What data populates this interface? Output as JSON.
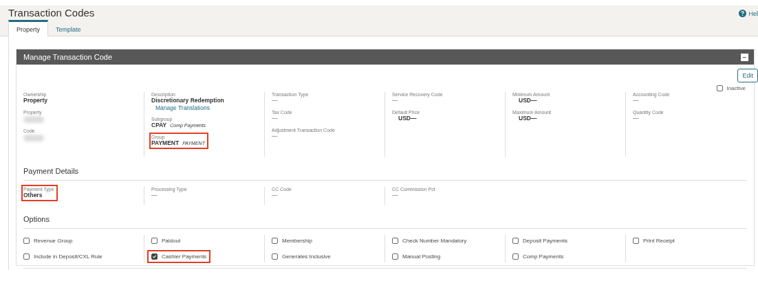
{
  "page": {
    "title": "Transaction Codes",
    "help": "Hel"
  },
  "tabs": [
    {
      "label": "Property",
      "selected": true
    },
    {
      "label": "Template",
      "selected": false
    }
  ],
  "panel": {
    "title": "Manage Transaction Code",
    "collapse": "−",
    "edit": "Edit",
    "inactive": {
      "label": "Inactive",
      "checked": false
    }
  },
  "details": {
    "columns": [
      [
        {
          "label": "Ownership",
          "kind": "bold",
          "value": "Property",
          "highlighted": false
        },
        {
          "label": "Property",
          "kind": "redacted",
          "highlighted": false
        },
        {
          "label": "Code",
          "kind": "redacted",
          "highlighted": false
        }
      ],
      [
        {
          "label": "Description",
          "kind": "bold",
          "value": "Discretionary Redemption",
          "link": "Manage Translations",
          "highlighted": false
        },
        {
          "label": "Subgroup",
          "kind": "bold",
          "value": "CPAY",
          "note": "Comp Payments",
          "highlighted": false
        },
        {
          "label": "Group",
          "kind": "bold",
          "value": "PAYMENT",
          "note": "PAYMENT",
          "highlighted": true
        }
      ],
      [
        {
          "label": "Transaction Type",
          "kind": "plain",
          "value": "—",
          "highlighted": false
        },
        {
          "label": "Tax Code",
          "kind": "plain",
          "value": "—",
          "highlighted": false
        },
        {
          "label": "Adjustment Transaction Code",
          "kind": "plain",
          "value": "—",
          "highlighted": false
        }
      ],
      [
        {
          "label": "Service Recovery Code",
          "kind": "plain",
          "value": "—",
          "highlighted": false
        },
        {
          "label": "Default Price",
          "kind": "amount",
          "value": "USD—",
          "highlighted": false
        }
      ],
      [
        {
          "label": "Minimum Amount",
          "kind": "amount",
          "value": "USD—",
          "highlighted": false
        },
        {
          "label": "Maximum Amount",
          "kind": "amount",
          "value": "USD—",
          "highlighted": false
        }
      ],
      [
        {
          "label": "Accounting Code",
          "kind": "plain",
          "value": "—",
          "highlighted": false
        },
        {
          "label": "Quantity Code",
          "kind": "plain",
          "value": "—",
          "highlighted": false
        }
      ]
    ]
  },
  "payment_details": {
    "title": "Payment Details",
    "columns": [
      [
        {
          "label": "Payment Type",
          "kind": "bold",
          "value": "Others",
          "highlighted": true
        }
      ],
      [
        {
          "label": "Processing Type",
          "kind": "plain",
          "value": "—",
          "highlighted": false
        }
      ],
      [
        {
          "label": "CC Code",
          "kind": "plain",
          "value": "—",
          "highlighted": false
        }
      ],
      [
        {
          "label": "CC Commission Pct",
          "kind": "plain",
          "value": "—",
          "highlighted": false
        }
      ]
    ]
  },
  "options": {
    "title": "Options",
    "columns": [
      [
        {
          "label": "Revenue Group",
          "checked": false,
          "highlighted": false
        },
        {
          "label": "Include in Deposit/CXL Rule",
          "checked": false,
          "highlighted": false
        }
      ],
      [
        {
          "label": "Paidout",
          "checked": false,
          "highlighted": false
        },
        {
          "label": "Cashier Payments",
          "checked": true,
          "highlighted": true
        }
      ],
      [
        {
          "label": "Membership",
          "checked": false,
          "highlighted": false
        },
        {
          "label": "Generates Inclusive",
          "checked": false,
          "highlighted": false
        }
      ],
      [
        {
          "label": "Check Number Mandatory",
          "checked": false,
          "highlighted": false
        },
        {
          "label": "Manual Posting",
          "checked": false,
          "highlighted": false
        }
      ],
      [
        {
          "label": "Deposit Payments",
          "checked": false,
          "highlighted": false
        },
        {
          "label": "Comp Payments",
          "checked": false,
          "highlighted": false
        }
      ],
      [
        {
          "label": "Print Receipt",
          "checked": false,
          "highlighted": false
        }
      ]
    ]
  }
}
